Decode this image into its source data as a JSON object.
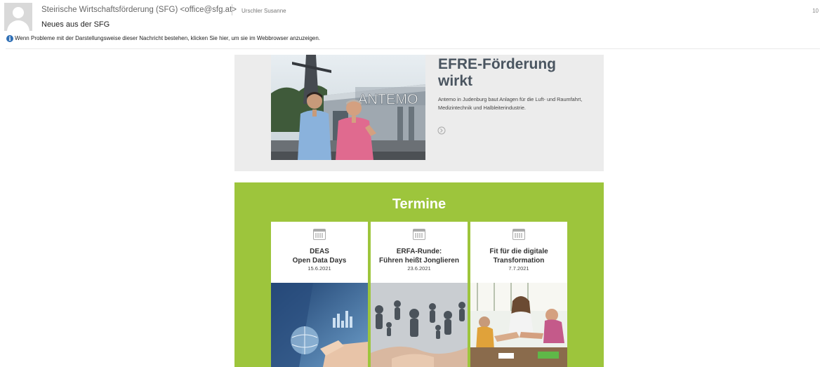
{
  "email": {
    "sender": "Steirische Wirtschaftsförderung (SFG) <office@sfg.at>",
    "to": "Urschler Susanne",
    "count": "10",
    "subject": "Neues aus der SFG",
    "info_text": "Wenn Probleme mit der Darstellungsweise dieser Nachricht bestehen, klicken Sie hier, um sie im Webbrowser anzuzeigen."
  },
  "efre": {
    "title": "EFRE-Förderung\nwirkt",
    "text": "Antemo in Judenburg baut Anlagen für die Luft- und Raumfahrt, Medizintechnik und Halbleiterindustrie.",
    "link_icon": "arrow-circle-icon",
    "building_sign": "ANTEMO"
  },
  "termine": {
    "title": "Termine",
    "events": [
      {
        "title": "DEAS\nOpen Data Days",
        "date": "15.6.2021"
      },
      {
        "title": "ERFA-Runde:\nFühren heißt Jonglieren",
        "date": "23.6.2021"
      },
      {
        "title": "Fit für die digitale\nTransformation",
        "date": "7.7.2021"
      }
    ]
  },
  "colors": {
    "termine_bg": "#9dc53c",
    "efre_bg": "#ececec",
    "info_blue": "#2f6fb5"
  }
}
